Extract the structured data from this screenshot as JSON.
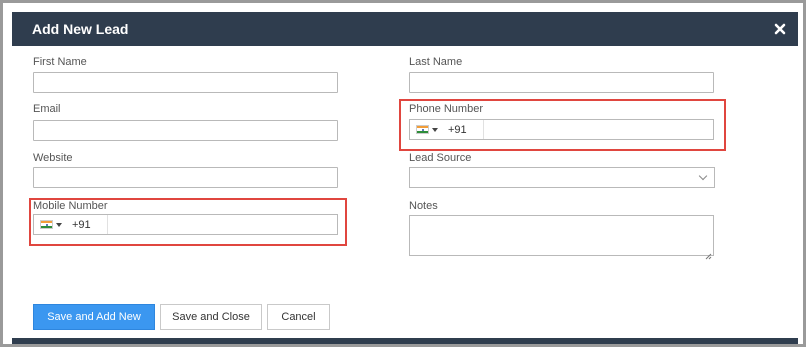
{
  "dialog": {
    "title": "Add New Lead",
    "close_icon": "close-icon"
  },
  "form": {
    "first_name": {
      "label": "First Name",
      "value": ""
    },
    "last_name": {
      "label": "Last Name",
      "value": ""
    },
    "email": {
      "label": "Email",
      "value": ""
    },
    "phone_number": {
      "label": "Phone Number",
      "country": "IN",
      "dial_code": "+91",
      "value": ""
    },
    "website": {
      "label": "Website",
      "value": ""
    },
    "lead_source": {
      "label": "Lead Source",
      "selected": ""
    },
    "mobile_number": {
      "label": "Mobile Number",
      "country": "IN",
      "dial_code": "+91",
      "value": ""
    },
    "notes": {
      "label": "Notes",
      "value": ""
    }
  },
  "buttons": {
    "save_add_new": "Save and Add New",
    "save_close": "Save and Close",
    "cancel": "Cancel"
  },
  "colors": {
    "header_bg": "#2f3d4e",
    "primary_button": "#3b97f0",
    "highlight": "#e0463f"
  }
}
